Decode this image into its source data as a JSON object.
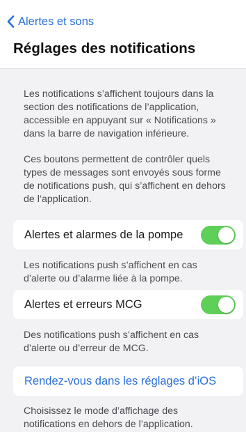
{
  "header": {
    "back_label": "Alertes et sons",
    "title": "Réglages des notifications"
  },
  "intro": {
    "paragraph_1": "Les notifications s’affichent toujours dans la section des notifications de l’application, accessible en appuyant sur « Notifications » dans la barre de navigation inférieure.",
    "paragraph_2": "Ces boutons permettent de contrôler quels types de messages sont envoyés sous forme de notifications push, qui s’affichent en dehors de l’application."
  },
  "settings": [
    {
      "label": "Alertes et alarmes de la pompe",
      "toggle_on": true,
      "footnote": "Les notifications push s’affichent en cas d’alerte ou d’alarme liée à la pompe."
    },
    {
      "label": "Alertes et erreurs MCG",
      "toggle_on": true,
      "footnote": "Des notifications push s’affichent en cas d’alerte ou d’erreur de MCG."
    }
  ],
  "ios_link": {
    "label": "Rendez-vous dans les réglages d’iOS",
    "footnote": "Choisissez le mode d’affichage des notifications en dehors de l’application."
  },
  "colors": {
    "accent": "#2a6fdb",
    "toggle_on": "#5ed058",
    "background": "#f2f2f4"
  },
  "icons": {
    "back": "chevron-left-icon"
  }
}
